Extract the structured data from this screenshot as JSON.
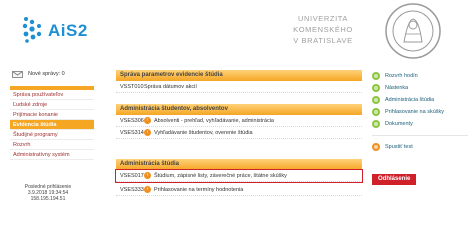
{
  "header": {
    "logo_text": "AiS2",
    "university_line1": "UNIVERZITA KOMENSKÉHO",
    "university_line2": "V BRATISLAVE"
  },
  "mail": {
    "label": "Nové správy: 0"
  },
  "left_menu": {
    "items": [
      {
        "label": "Správa používateľov",
        "active": false
      },
      {
        "label": "Ľudské zdroje",
        "active": false
      },
      {
        "label": "Prijímacie konanie",
        "active": false
      },
      {
        "label": "Evidencia štúdia",
        "active": true
      },
      {
        "label": "Študijné programy",
        "active": false
      },
      {
        "label": "Rozvrh",
        "active": false
      },
      {
        "label": "Administratívny systém",
        "active": false
      }
    ]
  },
  "last_login": {
    "label": "Posledné prihlásenie",
    "datetime": "3.9.2018 19:34:54",
    "ip": "158.195.194.51"
  },
  "panels": [
    {
      "title": "Správa parametrov evidencie štúdia",
      "rows": [
        {
          "code": "VSST010",
          "title": "Správa dátumov akcií"
        }
      ]
    },
    {
      "title": "Administrácia študentov, absolventov",
      "rows": [
        {
          "code": "VSES306",
          "title": "Absolventi - prehľad, vyhľadávanie, administrácia"
        },
        {
          "code": "VSES314",
          "title": "Vyhľadávanie študentov, overenie štúdia"
        }
      ]
    },
    {
      "title": "Administrácia štúdia",
      "rows": [
        {
          "code": "VSES017",
          "title": "Štúdium, zápisné listy, záverečné práce, štátne skúšky",
          "highlight": true
        },
        {
          "code": "VSES333",
          "title": "Prihlasovanie na termíny hodnotenia"
        }
      ]
    }
  ],
  "right_menu": {
    "items": [
      {
        "label": "Rozvrh hodín",
        "color": "#8cc63f"
      },
      {
        "label": "Nástenka",
        "color": "#8cc63f"
      },
      {
        "label": "Administrácia štúdia",
        "color": "#8cc63f"
      },
      {
        "label": "Prihlasovanie na skúšky",
        "color": "#8cc63f"
      },
      {
        "label": "Dokumenty",
        "color": "#8cc63f"
      }
    ],
    "launch_label": "Spustiť test",
    "launch_color": "#f09020",
    "logout_label": "Odhlásenie"
  },
  "colors": {
    "accent_orange": "#f5a623",
    "logo_blue": "#1e8fd0",
    "highlight_red": "#d0202a"
  }
}
